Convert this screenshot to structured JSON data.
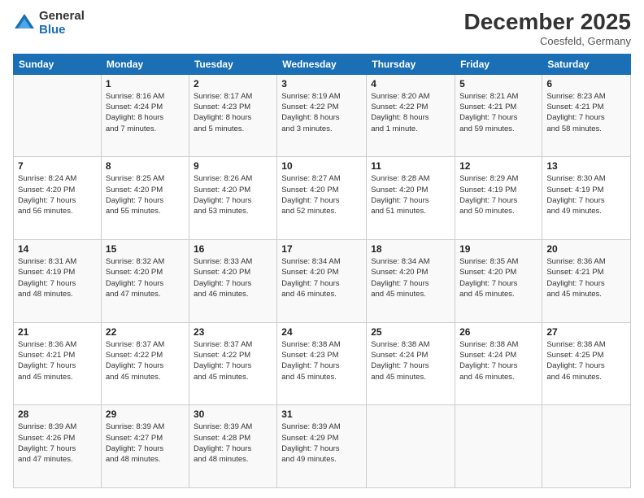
{
  "logo": {
    "general": "General",
    "blue": "Blue"
  },
  "header": {
    "month": "December 2025",
    "location": "Coesfeld, Germany"
  },
  "days_of_week": [
    "Sunday",
    "Monday",
    "Tuesday",
    "Wednesday",
    "Thursday",
    "Friday",
    "Saturday"
  ],
  "weeks": [
    [
      {
        "day": "",
        "info": ""
      },
      {
        "day": "1",
        "info": "Sunrise: 8:16 AM\nSunset: 4:24 PM\nDaylight: 8 hours\nand 7 minutes."
      },
      {
        "day": "2",
        "info": "Sunrise: 8:17 AM\nSunset: 4:23 PM\nDaylight: 8 hours\nand 5 minutes."
      },
      {
        "day": "3",
        "info": "Sunrise: 8:19 AM\nSunset: 4:22 PM\nDaylight: 8 hours\nand 3 minutes."
      },
      {
        "day": "4",
        "info": "Sunrise: 8:20 AM\nSunset: 4:22 PM\nDaylight: 8 hours\nand 1 minute."
      },
      {
        "day": "5",
        "info": "Sunrise: 8:21 AM\nSunset: 4:21 PM\nDaylight: 7 hours\nand 59 minutes."
      },
      {
        "day": "6",
        "info": "Sunrise: 8:23 AM\nSunset: 4:21 PM\nDaylight: 7 hours\nand 58 minutes."
      }
    ],
    [
      {
        "day": "7",
        "info": "Sunrise: 8:24 AM\nSunset: 4:20 PM\nDaylight: 7 hours\nand 56 minutes."
      },
      {
        "day": "8",
        "info": "Sunrise: 8:25 AM\nSunset: 4:20 PM\nDaylight: 7 hours\nand 55 minutes."
      },
      {
        "day": "9",
        "info": "Sunrise: 8:26 AM\nSunset: 4:20 PM\nDaylight: 7 hours\nand 53 minutes."
      },
      {
        "day": "10",
        "info": "Sunrise: 8:27 AM\nSunset: 4:20 PM\nDaylight: 7 hours\nand 52 minutes."
      },
      {
        "day": "11",
        "info": "Sunrise: 8:28 AM\nSunset: 4:20 PM\nDaylight: 7 hours\nand 51 minutes."
      },
      {
        "day": "12",
        "info": "Sunrise: 8:29 AM\nSunset: 4:19 PM\nDaylight: 7 hours\nand 50 minutes."
      },
      {
        "day": "13",
        "info": "Sunrise: 8:30 AM\nSunset: 4:19 PM\nDaylight: 7 hours\nand 49 minutes."
      }
    ],
    [
      {
        "day": "14",
        "info": "Sunrise: 8:31 AM\nSunset: 4:19 PM\nDaylight: 7 hours\nand 48 minutes."
      },
      {
        "day": "15",
        "info": "Sunrise: 8:32 AM\nSunset: 4:20 PM\nDaylight: 7 hours\nand 47 minutes."
      },
      {
        "day": "16",
        "info": "Sunrise: 8:33 AM\nSunset: 4:20 PM\nDaylight: 7 hours\nand 46 minutes."
      },
      {
        "day": "17",
        "info": "Sunrise: 8:34 AM\nSunset: 4:20 PM\nDaylight: 7 hours\nand 46 minutes."
      },
      {
        "day": "18",
        "info": "Sunrise: 8:34 AM\nSunset: 4:20 PM\nDaylight: 7 hours\nand 45 minutes."
      },
      {
        "day": "19",
        "info": "Sunrise: 8:35 AM\nSunset: 4:20 PM\nDaylight: 7 hours\nand 45 minutes."
      },
      {
        "day": "20",
        "info": "Sunrise: 8:36 AM\nSunset: 4:21 PM\nDaylight: 7 hours\nand 45 minutes."
      }
    ],
    [
      {
        "day": "21",
        "info": "Sunrise: 8:36 AM\nSunset: 4:21 PM\nDaylight: 7 hours\nand 45 minutes."
      },
      {
        "day": "22",
        "info": "Sunrise: 8:37 AM\nSunset: 4:22 PM\nDaylight: 7 hours\nand 45 minutes."
      },
      {
        "day": "23",
        "info": "Sunrise: 8:37 AM\nSunset: 4:22 PM\nDaylight: 7 hours\nand 45 minutes."
      },
      {
        "day": "24",
        "info": "Sunrise: 8:38 AM\nSunset: 4:23 PM\nDaylight: 7 hours\nand 45 minutes."
      },
      {
        "day": "25",
        "info": "Sunrise: 8:38 AM\nSunset: 4:24 PM\nDaylight: 7 hours\nand 45 minutes."
      },
      {
        "day": "26",
        "info": "Sunrise: 8:38 AM\nSunset: 4:24 PM\nDaylight: 7 hours\nand 46 minutes."
      },
      {
        "day": "27",
        "info": "Sunrise: 8:38 AM\nSunset: 4:25 PM\nDaylight: 7 hours\nand 46 minutes."
      }
    ],
    [
      {
        "day": "28",
        "info": "Sunrise: 8:39 AM\nSunset: 4:26 PM\nDaylight: 7 hours\nand 47 minutes."
      },
      {
        "day": "29",
        "info": "Sunrise: 8:39 AM\nSunset: 4:27 PM\nDaylight: 7 hours\nand 48 minutes."
      },
      {
        "day": "30",
        "info": "Sunrise: 8:39 AM\nSunset: 4:28 PM\nDaylight: 7 hours\nand 48 minutes."
      },
      {
        "day": "31",
        "info": "Sunrise: 8:39 AM\nSunset: 4:29 PM\nDaylight: 7 hours\nand 49 minutes."
      },
      {
        "day": "",
        "info": ""
      },
      {
        "day": "",
        "info": ""
      },
      {
        "day": "",
        "info": ""
      }
    ]
  ]
}
